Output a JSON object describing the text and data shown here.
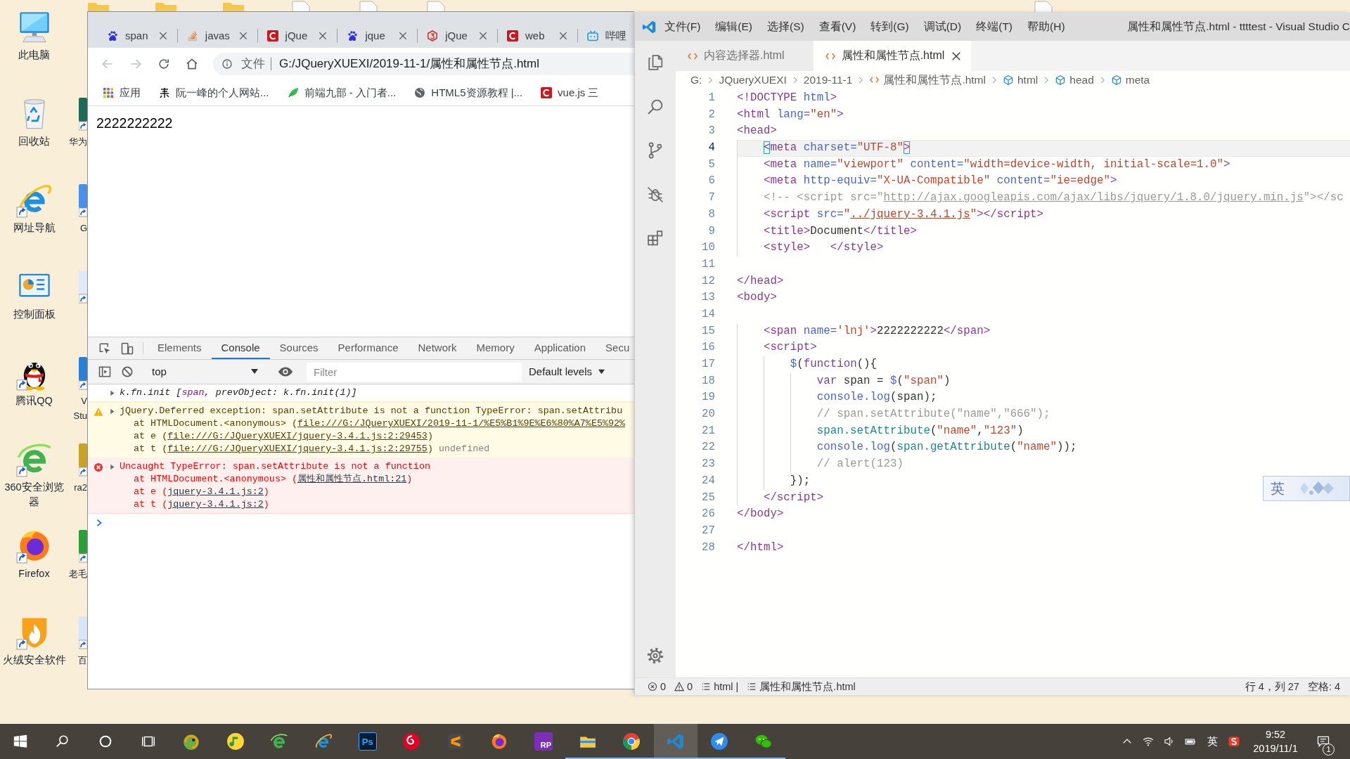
{
  "desktop": {
    "top_icons": [
      {
        "kind": "folder"
      },
      {
        "kind": "folder"
      },
      {
        "kind": "folder"
      },
      {
        "kind": "sheet"
      },
      {
        "kind": "sheet"
      },
      {
        "kind": "sheet"
      },
      {
        "kind": "sheet"
      }
    ],
    "icons": [
      {
        "label": "此电脑",
        "kind": "computer",
        "shortcut": false
      },
      {
        "label": "回收站",
        "kind": "recycle",
        "shortcut": false
      },
      {
        "label": "网址导航",
        "kind": "ie",
        "shortcut": true
      },
      {
        "label": "控制面板",
        "kind": "panel",
        "shortcut": false
      },
      {
        "label": "腾讯QQ",
        "kind": "penguin",
        "shortcut": true
      },
      {
        "label": "360安全浏览器",
        "kind": "green-e",
        "shortcut": true
      },
      {
        "label": "Firefox",
        "kind": "firefox",
        "shortcut": true
      },
      {
        "label": "火绒安全软件",
        "kind": "flame",
        "shortcut": true
      }
    ],
    "covered_icons": [
      {
        "label": "华为",
        "color": "#1f6b5a"
      },
      {
        "label": "G",
        "color": "#4a8fe8"
      },
      {
        "color": "#dfe9f7"
      },
      {
        "label": "V Stu",
        "color": "#2b7fd4"
      },
      {
        "label": "ra2",
        "color": "#c9a227"
      },
      {
        "label": "老毛",
        "color": "#2e9e3a"
      },
      {
        "label": "百",
        "color": "#d6e6f8"
      }
    ]
  },
  "browser": {
    "tabs": [
      {
        "title": "span",
        "kind": "paw",
        "selected": false
      },
      {
        "title": "javas",
        "kind": "stack",
        "selected": false
      },
      {
        "title": "jQue",
        "kind": "c-mark",
        "selected": false
      },
      {
        "title": "jque",
        "kind": "paw",
        "selected": false
      },
      {
        "title": "jQue",
        "kind": "hexagon",
        "selected": false
      },
      {
        "title": "web",
        "kind": "c-mark",
        "selected": false
      },
      {
        "title": "哔哩",
        "kind": "tv",
        "selected": false
      }
    ],
    "nav_buttons": [
      {
        "kind": "back",
        "disabled": true
      },
      {
        "kind": "forward",
        "disabled": true
      },
      {
        "kind": "reload",
        "disabled": false
      },
      {
        "kind": "home",
        "disabled": false
      }
    ],
    "address": {
      "scheme_label": "文件",
      "url": "G:/JQueryXUEXI/2019-11-1/属性和属性节点.html"
    },
    "bookmarks": [
      {
        "label": "应用",
        "kind": "apps"
      },
      {
        "label": "阮一峰的个人网站...",
        "kind": "brush"
      },
      {
        "label": "前端九部 - 入门者...",
        "kind": "leaf"
      },
      {
        "label": "HTML5资源教程 |...",
        "kind": "globe"
      },
      {
        "label": "vue.js 三",
        "kind": "c-mark"
      }
    ],
    "page": {
      "text": "2222222222"
    },
    "devtools": {
      "tabs": [
        {
          "label": "Elements",
          "selected": false
        },
        {
          "label": "Console",
          "selected": true
        },
        {
          "label": "Sources",
          "selected": false
        },
        {
          "label": "Performance",
          "selected": false
        },
        {
          "label": "Network",
          "selected": false
        },
        {
          "label": "Memory",
          "selected": false
        },
        {
          "label": "Application",
          "selected": false
        },
        {
          "label": "Secu",
          "selected": false
        }
      ],
      "context": "top",
      "filter": {
        "placeholder": "Filter"
      },
      "levels": "Default levels",
      "messages": [
        {
          "kind": "log",
          "expanded": false,
          "lines": [
            {
              "segments": [
                {
                  "kind": "text",
                  "text": "k.fn.init ["
                },
                {
                  "kind": "node",
                  "text": "span"
                },
                {
                  "kind": "text",
                  "text": ", prevObject: k.fn.init(1)]"
                }
              ]
            }
          ]
        },
        {
          "kind": "warning",
          "expanded": false,
          "lines": [
            {
              "segments": [
                {
                  "kind": "text",
                  "text": "jQuery.Deferred exception: span.setAttribute is not a function TypeError: span.setAttribu"
                }
              ]
            },
            {
              "segments": [
                {
                  "kind": "text",
                  "text": "at HTMLDocument.<anonymous> ("
                },
                {
                  "kind": "link",
                  "text": "file:///G:/JQueryXUEXI/2019-11-1/%E5%B1%9E%E6%80%A7%E5%92%"
                }
              ]
            },
            {
              "segments": [
                {
                  "kind": "text",
                  "text": "at e ("
                },
                {
                  "kind": "link",
                  "text": "file:///G:/JQueryXUEXI/jquery-3.4.1.js:2:29453"
                },
                {
                  "kind": "text",
                  "text": ")"
                }
              ]
            },
            {
              "segments": [
                {
                  "kind": "text",
                  "text": "at t ("
                },
                {
                  "kind": "link",
                  "text": "file:///G:/JQueryXUEXI/jquery-3.4.1.js:2:29755"
                },
                {
                  "kind": "text",
                  "text": ") "
                },
                {
                  "kind": "muted",
                  "text": "undefined"
                }
              ]
            }
          ]
        },
        {
          "kind": "error",
          "expanded": false,
          "lines": [
            {
              "segments": [
                {
                  "kind": "text",
                  "text": "Uncaught TypeError: span.setAttribute is not a function"
                }
              ]
            },
            {
              "segments": [
                {
                  "kind": "text",
                  "text": "at HTMLDocument.<anonymous> ("
                },
                {
                  "kind": "link",
                  "text": "属性和属性节点.html:21"
                },
                {
                  "kind": "text",
                  "text": ")"
                }
              ]
            },
            {
              "segments": [
                {
                  "kind": "text",
                  "text": "at e ("
                },
                {
                  "kind": "link",
                  "text": "jquery-3.4.1.js:2"
                },
                {
                  "kind": "text",
                  "text": ")"
                }
              ]
            },
            {
              "segments": [
                {
                  "kind": "text",
                  "text": "at t ("
                },
                {
                  "kind": "link",
                  "text": "jquery-3.4.1.js:2"
                },
                {
                  "kind": "text",
                  "text": ")"
                }
              ]
            }
          ]
        }
      ]
    }
  },
  "vscode": {
    "menu": [
      "文件(F)",
      "编辑(E)",
      "选择(S)",
      "查看(V)",
      "转到(G)",
      "调试(D)",
      "终端(T)",
      "帮助(H)"
    ],
    "title": "属性和属性节点.html - ttttest - Visual Studio C",
    "activity_bar": [
      {
        "kind": "files"
      },
      {
        "kind": "search"
      },
      {
        "kind": "source-control"
      },
      {
        "kind": "debug"
      },
      {
        "kind": "extensions"
      },
      {
        "kind": "settings"
      }
    ],
    "tabs": [
      {
        "label": "内容选择器.html",
        "selected": false
      },
      {
        "label": "属性和属性节点.html",
        "selected": true
      }
    ],
    "breadcrumbs": [
      {
        "label": "G:",
        "kind": "folder"
      },
      {
        "label": "JQueryXUEXI",
        "kind": "folder"
      },
      {
        "label": "2019-11-1",
        "kind": "folder"
      },
      {
        "label": "属性和属性节点.html",
        "kind": "file"
      },
      {
        "label": "html",
        "kind": "element"
      },
      {
        "label": "head",
        "kind": "element"
      },
      {
        "label": "meta",
        "kind": "element"
      }
    ],
    "lines": [
      {
        "number": "1",
        "current": false,
        "segments": [
          {
            "kind": "tag",
            "text": "<!DOCTYPE"
          },
          {
            "kind": "attr",
            "text": " html"
          },
          {
            "kind": "tag",
            "text": ">"
          }
        ]
      },
      {
        "number": "2",
        "current": false,
        "segments": [
          {
            "kind": "tag",
            "text": "<html"
          },
          {
            "kind": "attr",
            "text": " lang="
          },
          {
            "kind": "string",
            "text": "\"en\""
          },
          {
            "kind": "tag",
            "text": ">"
          }
        ]
      },
      {
        "number": "3",
        "current": false,
        "segments": [
          {
            "kind": "tag",
            "text": "<head>"
          }
        ]
      },
      {
        "number": "4",
        "current": true,
        "segments": [
          {
            "kind": "tag-match",
            "text": "    <"
          },
          {
            "kind": "tag",
            "text": "meta"
          },
          {
            "kind": "attr",
            "text": " charset="
          },
          {
            "kind": "string",
            "text": "\"UTF-8\""
          },
          {
            "kind": "tag-match",
            "text": ">"
          }
        ]
      },
      {
        "number": "5",
        "current": false,
        "segments": [
          {
            "kind": "tag",
            "text": "    <meta"
          },
          {
            "kind": "attr",
            "text": " name="
          },
          {
            "kind": "string",
            "text": "\"viewport\""
          },
          {
            "kind": "attr",
            "text": " content="
          },
          {
            "kind": "string",
            "text": "\"width=device-width, initial-scale=1.0\""
          },
          {
            "kind": "tag",
            "text": ">"
          }
        ]
      },
      {
        "number": "6",
        "current": false,
        "segments": [
          {
            "kind": "tag",
            "text": "    <meta"
          },
          {
            "kind": "attr",
            "text": " http-equiv="
          },
          {
            "kind": "string",
            "text": "\"X-UA-Compatible\""
          },
          {
            "kind": "attr",
            "text": " content="
          },
          {
            "kind": "string",
            "text": "\"ie=edge\""
          },
          {
            "kind": "tag",
            "text": ">"
          }
        ]
      },
      {
        "number": "7",
        "current": false,
        "segments": [
          {
            "kind": "comment",
            "text": "    <!-- <script src=\""
          },
          {
            "kind": "comment-link",
            "text": "http://ajax.googleapis.com/ajax/libs/jquery/1.8.0/jquery.min.js"
          },
          {
            "kind": "comment",
            "text": "\"></sc"
          }
        ]
      },
      {
        "number": "8",
        "current": false,
        "segments": [
          {
            "kind": "tag",
            "text": "    <script"
          },
          {
            "kind": "attr",
            "text": " src="
          },
          {
            "kind": "string",
            "text": "\""
          },
          {
            "kind": "string-link",
            "text": "../jquery-3.4.1.js"
          },
          {
            "kind": "string",
            "text": "\""
          },
          {
            "kind": "tag",
            "text": "></script>"
          }
        ]
      },
      {
        "number": "9",
        "current": false,
        "segments": [
          {
            "kind": "tag",
            "text": "    <title>"
          },
          {
            "kind": "plain",
            "text": "Document"
          },
          {
            "kind": "tag",
            "text": "</title>"
          }
        ]
      },
      {
        "number": "10",
        "current": false,
        "segments": [
          {
            "kind": "tag",
            "text": "    <style>   </style>"
          }
        ]
      },
      {
        "number": "11",
        "current": false
      },
      {
        "number": "12",
        "current": false,
        "segments": [
          {
            "kind": "tag",
            "text": "</head>"
          }
        ]
      },
      {
        "number": "13",
        "current": false,
        "segments": [
          {
            "kind": "tag",
            "text": "<body>"
          }
        ]
      },
      {
        "number": "14",
        "current": false
      },
      {
        "number": "15",
        "current": false,
        "segments": [
          {
            "kind": "tag",
            "text": "    <span"
          },
          {
            "kind": "attr",
            "text": " name="
          },
          {
            "kind": "string",
            "text": "'lnj'"
          },
          {
            "kind": "tag",
            "text": ">"
          },
          {
            "kind": "plain",
            "text": "2222222222"
          },
          {
            "kind": "tag",
            "text": "</span>"
          }
        ]
      },
      {
        "number": "16",
        "current": false,
        "segments": [
          {
            "kind": "tag",
            "text": "    <script>"
          }
        ]
      },
      {
        "number": "17",
        "current": false,
        "segments": [
          {
            "kind": "fn",
            "text": "        $"
          },
          {
            "kind": "plain",
            "text": "("
          },
          {
            "kind": "keyword",
            "text": "function"
          },
          {
            "kind": "plain",
            "text": "(){"
          }
        ]
      },
      {
        "number": "18",
        "current": false,
        "segments": [
          {
            "kind": "keyword",
            "text": "            var"
          },
          {
            "kind": "plain",
            "text": " span = "
          },
          {
            "kind": "fn",
            "text": "$"
          },
          {
            "kind": "plain",
            "text": "("
          },
          {
            "kind": "string",
            "text": "\"span\""
          },
          {
            "kind": "plain",
            "text": ")"
          }
        ]
      },
      {
        "number": "19",
        "current": false,
        "segments": [
          {
            "kind": "fn",
            "text": "            console.log"
          },
          {
            "kind": "plain",
            "text": "(span);"
          }
        ]
      },
      {
        "number": "20",
        "current": false,
        "segments": [
          {
            "kind": "comment",
            "text": "            // span.setAttribute(\"name\",\"666\");"
          }
        ]
      },
      {
        "number": "21",
        "current": false,
        "segments": [
          {
            "kind": "member",
            "text": "            span.setAttribute"
          },
          {
            "kind": "plain",
            "text": "("
          },
          {
            "kind": "string",
            "text": "\"name\""
          },
          {
            "kind": "plain",
            "text": ","
          },
          {
            "kind": "string",
            "text": "\"123\""
          },
          {
            "kind": "plain",
            "text": ")"
          }
        ]
      },
      {
        "number": "22",
        "current": false,
        "segments": [
          {
            "kind": "fn",
            "text": "            console.log"
          },
          {
            "kind": "plain",
            "text": "("
          },
          {
            "kind": "member",
            "text": "span.getAttribute"
          },
          {
            "kind": "plain",
            "text": "("
          },
          {
            "kind": "string",
            "text": "\"name\""
          },
          {
            "kind": "plain",
            "text": "));"
          }
        ]
      },
      {
        "number": "23",
        "current": false,
        "segments": [
          {
            "kind": "comment",
            "text": "            // alert(123)"
          }
        ]
      },
      {
        "number": "24",
        "current": false,
        "segments": [
          {
            "kind": "plain",
            "text": "        });"
          }
        ]
      },
      {
        "number": "25",
        "current": false,
        "segments": [
          {
            "kind": "tag",
            "text": "    </script>"
          }
        ]
      },
      {
        "number": "26",
        "current": false,
        "segments": [
          {
            "kind": "tag",
            "text": "</body>"
          }
        ]
      },
      {
        "number": "27",
        "current": false
      },
      {
        "number": "28",
        "current": false,
        "segments": [
          {
            "kind": "tag",
            "text": "</html>"
          }
        ]
      }
    ],
    "ime": {
      "label": "英"
    },
    "status_bar": {
      "errors": "0",
      "warnings": "0",
      "items": [
        "html |",
        "属性和属性节点.html"
      ],
      "position": "行 4，列 27",
      "indent": "空格: 4"
    }
  },
  "taskbar": {
    "apps": [
      {
        "kind": "chameleon",
        "running": false,
        "selected": false
      },
      {
        "kind": "music",
        "running": false,
        "selected": false
      },
      {
        "kind": "green-e",
        "running": false,
        "selected": false
      },
      {
        "kind": "ie",
        "running": false,
        "selected": false
      },
      {
        "kind": "photoshop",
        "label": "Ps",
        "running": false,
        "selected": false
      },
      {
        "kind": "netease",
        "running": false,
        "selected": false
      },
      {
        "kind": "sublime",
        "running": false,
        "selected": false
      },
      {
        "kind": "firefox",
        "running": false,
        "selected": false
      },
      {
        "kind": "axure",
        "label": "RP",
        "running": false,
        "selected": false
      },
      {
        "kind": "explorer",
        "running": true,
        "selected": false
      },
      {
        "kind": "chrome",
        "running": true,
        "selected": false
      },
      {
        "kind": "vscode",
        "running": true,
        "selected": true
      },
      {
        "kind": "bird",
        "running": true,
        "selected": false
      },
      {
        "kind": "wechat",
        "running": true,
        "selected": false
      }
    ],
    "tray": {
      "input_mode": "英",
      "time": "9:52",
      "date": "2019/11/1",
      "notification_count": "1"
    }
  }
}
